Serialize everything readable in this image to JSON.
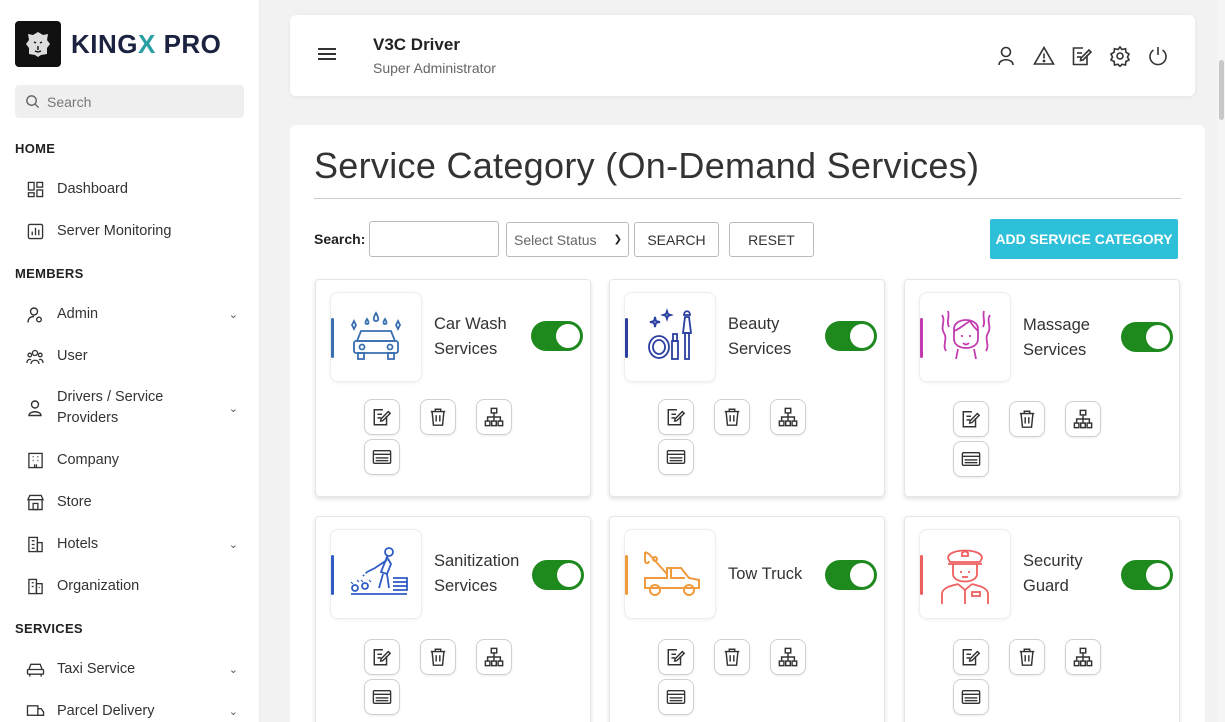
{
  "brand": {
    "name_main": "KING",
    "name_accent": "X",
    "name_tail": " PRO"
  },
  "sidebar": {
    "search_placeholder": "Search",
    "sections": {
      "home": "HOME",
      "members": "MEMBERS",
      "services": "SERVICES"
    },
    "items": [
      {
        "label": "Dashboard",
        "icon": "dashboard-icon"
      },
      {
        "label": "Server Monitoring",
        "icon": "monitor-icon"
      },
      {
        "label": "Admin",
        "icon": "admin-icon",
        "has_children": true
      },
      {
        "label": "User",
        "icon": "users-icon"
      },
      {
        "label": "Drivers / Service Providers",
        "icon": "driver-icon",
        "has_children": true
      },
      {
        "label": "Company",
        "icon": "company-icon"
      },
      {
        "label": "Store",
        "icon": "store-icon"
      },
      {
        "label": "Hotels",
        "icon": "hotel-icon",
        "has_children": true
      },
      {
        "label": "Organization",
        "icon": "organization-icon"
      },
      {
        "label": "Taxi Service",
        "icon": "taxi-icon",
        "has_children": true
      },
      {
        "label": "Parcel Delivery",
        "icon": "parcel-icon",
        "has_children": true
      }
    ]
  },
  "header": {
    "user_name": "V3C Driver",
    "user_role": "Super Administrator",
    "icons": [
      "profile-icon",
      "alert-icon",
      "edit-icon",
      "settings-icon",
      "power-icon"
    ]
  },
  "page": {
    "title": "Service Category (On-Demand Services)",
    "filters": {
      "search_label": "Search:",
      "search_value": "",
      "status_value": "Select Status",
      "search_button": "SEARCH",
      "reset_button": "RESET",
      "add_button": "ADD SERVICE CATEGORY"
    }
  },
  "categories": [
    {
      "name": "Car Wash Services",
      "icon": "car-wash-icon",
      "accent": "#3a6fb0",
      "enabled": true
    },
    {
      "name": "Beauty Services",
      "icon": "beauty-icon",
      "accent": "#2a3fa0",
      "enabled": true
    },
    {
      "name": "Massage Services",
      "icon": "massage-icon",
      "accent": "#c23bb0",
      "enabled": true
    },
    {
      "name": "Sanitization Services",
      "icon": "sanitization-icon",
      "accent": "#2f5cc4",
      "enabled": true
    },
    {
      "name": "Tow Truck",
      "icon": "tow-truck-icon",
      "accent": "#f09a3e",
      "enabled": true
    },
    {
      "name": "Security Guard",
      "icon": "security-guard-icon",
      "accent": "#ee5f5f",
      "enabled": true
    }
  ],
  "colors": {
    "toggle_on": "#1e8a1e",
    "add_button": "#2ec0d8",
    "accent_teal": "#2aa0a4"
  }
}
